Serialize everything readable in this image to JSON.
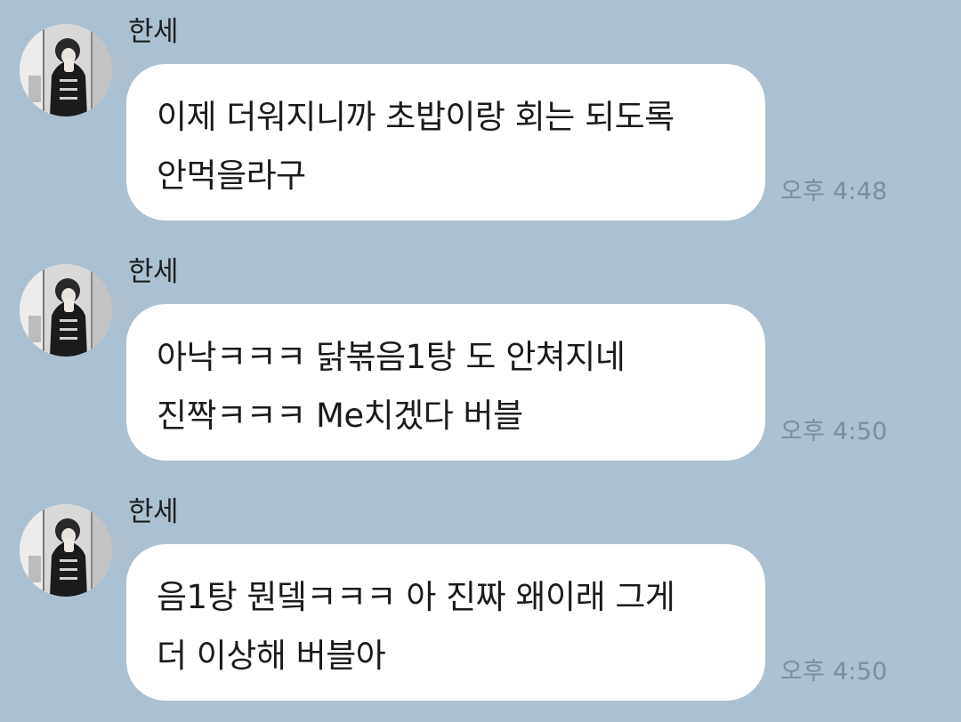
{
  "messages": [
    {
      "sender": "한세",
      "lines": [
        "이제 더워지니까 초밥이랑 회는 되도록",
        "안먹을라구"
      ],
      "time": "오후 4:48"
    },
    {
      "sender": "한세",
      "lines": [
        "아낙ㅋㅋㅋ 닭볶음1탕 도 안쳐지네",
        "진짝ㅋㅋㅋ Me치겠다 버블"
      ],
      "time": "오후 4:50"
    },
    {
      "sender": "한세",
      "lines": [
        "음1탕 뭔뎈ㅋㅋㅋ 아 진짜 왜이래 그게",
        "더 이상해 버블아"
      ],
      "time": "오후 4:50"
    }
  ],
  "colors": {
    "background": "#abc1d1",
    "bubble": "#ffffff",
    "time_text": "#7f8d99"
  },
  "icons": {
    "avatar": "profile-photo"
  }
}
